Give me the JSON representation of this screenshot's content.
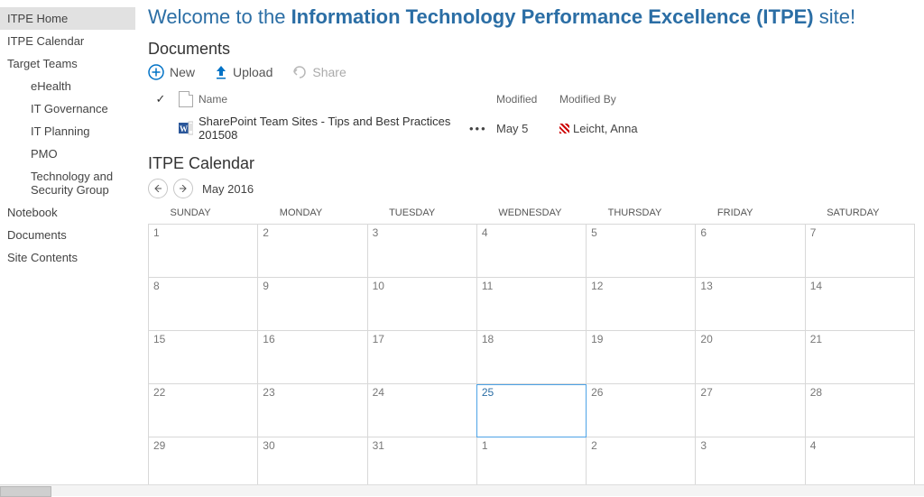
{
  "sidebar": {
    "items": [
      {
        "label": "ITPE Home",
        "selected": true
      },
      {
        "label": "ITPE Calendar"
      },
      {
        "label": "Target Teams"
      },
      {
        "label": "eHealth",
        "sub": true
      },
      {
        "label": "IT Governance",
        "sub": true
      },
      {
        "label": "IT Planning",
        "sub": true
      },
      {
        "label": "PMO",
        "sub": true
      },
      {
        "label": "Technology and Security Group",
        "sub": true
      },
      {
        "label": "Notebook"
      },
      {
        "label": "Documents"
      },
      {
        "label": "Site Contents"
      }
    ]
  },
  "welcome": {
    "prefix": "Welcome to the ",
    "bold": "Information Technology Performance Excellence (ITPE)",
    "suffix": " site!"
  },
  "documents": {
    "title": "Documents",
    "toolbar": {
      "new": "New",
      "upload": "Upload",
      "share": "Share"
    },
    "headers": {
      "name": "Name",
      "modified": "Modified",
      "modifiedBy": "Modified By"
    },
    "rows": [
      {
        "name": "SharePoint Team Sites - Tips and Best Practices 201508",
        "modified": "May 5",
        "modifiedBy": "Leicht, Anna"
      }
    ]
  },
  "calendar": {
    "title": "ITPE Calendar",
    "month": "May 2016",
    "dayHeaders": [
      "SUNDAY",
      "MONDAY",
      "TUESDAY",
      "WEDNESDAY",
      "THURSDAY",
      "FRIDAY",
      "SATURDAY"
    ],
    "weeks": [
      [
        "1",
        "2",
        "3",
        "4",
        "5",
        "6",
        "7"
      ],
      [
        "8",
        "9",
        "10",
        "11",
        "12",
        "13",
        "14"
      ],
      [
        "15",
        "16",
        "17",
        "18",
        "19",
        "20",
        "21"
      ],
      [
        "22",
        "23",
        "24",
        "25",
        "26",
        "27",
        "28"
      ],
      [
        "29",
        "30",
        "31",
        "1",
        "2",
        "3",
        "4"
      ]
    ],
    "today": "25"
  }
}
